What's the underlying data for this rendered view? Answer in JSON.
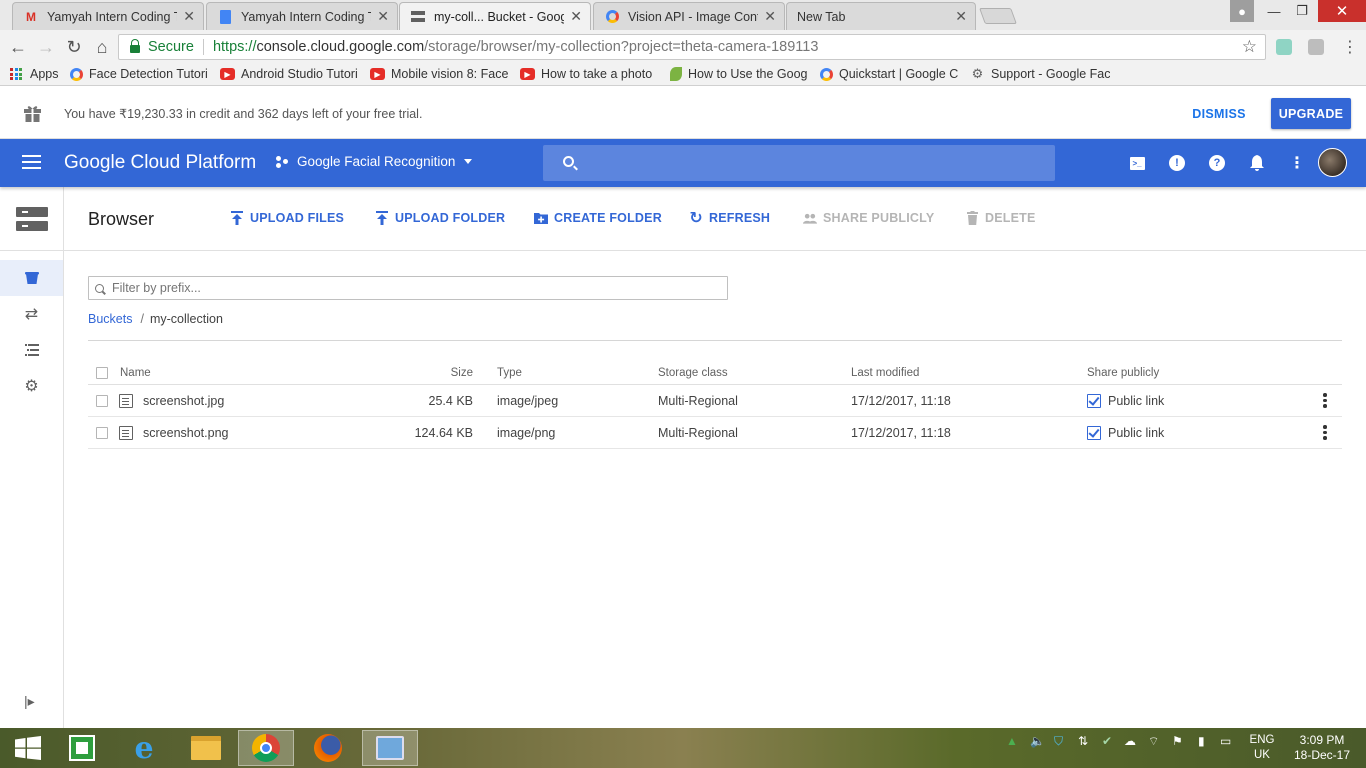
{
  "browser": {
    "tabs": [
      {
        "title": "Yamyah Intern Coding Te",
        "icon": "gmail-icon",
        "active": false
      },
      {
        "title": "Yamyah Intern Coding Te",
        "icon": "docs-icon",
        "active": false
      },
      {
        "title": "my-coll... Bucket - Googl",
        "icon": "storage-icon",
        "active": true
      },
      {
        "title": "Vision API - Image Conte",
        "icon": "google-cloud-icon",
        "active": false
      },
      {
        "title": "New Tab",
        "icon": "",
        "active": false
      }
    ],
    "address": {
      "secure_label": "Secure",
      "url_scheme": "https://",
      "url_host": "console.cloud.google.com",
      "url_path": "/storage/browser/my-collection?project=theta-camera-189113"
    },
    "bookmarks": [
      {
        "label": "Apps",
        "icon": "apps-grid-icon"
      },
      {
        "label": "Face Detection Tutori",
        "icon": "google-cloud-icon"
      },
      {
        "label": "Android Studio Tutori",
        "icon": "youtube-icon"
      },
      {
        "label": "Mobile vision 8: Face",
        "icon": "youtube-icon"
      },
      {
        "label": "How to take a photo",
        "icon": "youtube-icon"
      },
      {
        "label": "How to Use the Goog",
        "icon": "leaf-icon"
      },
      {
        "label": "Quickstart | Google C",
        "icon": "google-cloud-icon"
      },
      {
        "label": "Support - Google Fac",
        "icon": "gear-icon"
      }
    ]
  },
  "trial_banner": {
    "message": "You have ₹19,230.33 in credit and 362 days left of your free trial.",
    "dismiss_label": "DISMISS",
    "upgrade_label": "UPGRADE"
  },
  "header": {
    "product": "Google Cloud Platform",
    "project": "Google Facial Recognition"
  },
  "storage": {
    "page_title": "Browser",
    "actions": {
      "upload_files": "UPLOAD FILES",
      "upload_folder": "UPLOAD FOLDER",
      "create_folder": "CREATE FOLDER",
      "refresh": "REFRESH",
      "share_publicly": "SHARE PUBLICLY",
      "delete": "DELETE"
    },
    "filter_placeholder": "Filter by prefix...",
    "breadcrumb": {
      "root": "Buckets",
      "separator": "/",
      "current": "my-collection"
    },
    "columns": {
      "name": "Name",
      "size": "Size",
      "type": "Type",
      "storage_class": "Storage class",
      "last_modified": "Last modified",
      "share_publicly": "Share publicly"
    },
    "rows": [
      {
        "name": "screenshot.jpg",
        "size": "25.4 KB",
        "type": "image/jpeg",
        "storage_class": "Multi-Regional",
        "last_modified": "17/12/2017, 11:18",
        "share": "Public link"
      },
      {
        "name": "screenshot.png",
        "size": "124.64 KB",
        "type": "image/png",
        "storage_class": "Multi-Regional",
        "last_modified": "17/12/2017, 11:18",
        "share": "Public link"
      }
    ]
  },
  "taskbar": {
    "lang_top": "ENG",
    "lang_bottom": "UK",
    "time": "3:09 PM",
    "date": "18-Dec-17"
  },
  "colors": {
    "gcp_blue": "#3367d6",
    "secure_green": "#188038",
    "disabled_text": "#b5b5b5"
  }
}
